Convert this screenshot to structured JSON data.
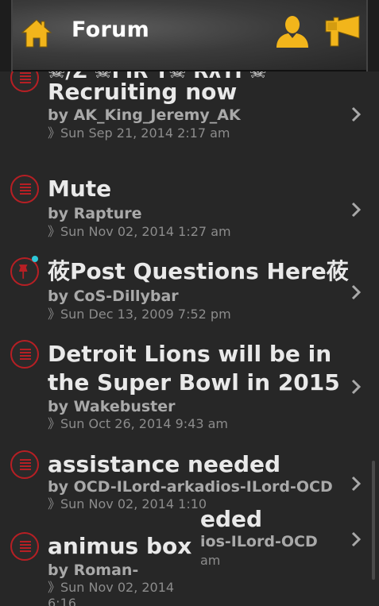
{
  "header": {
    "title": "Forum",
    "home_icon": "home-icon",
    "user_icon": "user-icon",
    "horn_icon": "horn-icon"
  },
  "colors": {
    "accent_gold": "#f2b51b",
    "topic_red": "#b71f24",
    "unread_dot": "#2ec7d8",
    "background": "#272727"
  },
  "topics": [
    {
      "title": "☠/Z ☠FIR T☠   RλTI ☠",
      "author": "",
      "date": ""
    },
    {
      "title": "Recruiting now",
      "author": "by AK_King_Jeremy_AK",
      "date": "》Sun Sep 21, 2014 2:17 am"
    },
    {
      "title": "Mute",
      "author": "by Rapture",
      "date": "》Sun Nov 02, 2014 1:27 am"
    },
    {
      "title": "莜Post Questions Here莜",
      "author": "by CoS-Dillybar",
      "date": "》Sun Dec 13, 2009 7:52 pm"
    },
    {
      "title": "Detroit Lions will be in the Super Bowl in 2015",
      "author": "by Wakebuster",
      "date": "》Sun Oct 26, 2014 9:43 am"
    },
    {
      "title": "assistance needed",
      "author": "by OCD-ILord-arkadios-ILord-OCD",
      "date": "》Sun Nov 02, 2014 1:10"
    },
    {
      "title": "animus box",
      "author": "by Roman-centurian",
      "date": "》Sun Nov 02, 2014 6:16"
    }
  ],
  "ghost": {
    "title": "eded",
    "author": "ios-ILord-OCD",
    "date": "am"
  }
}
